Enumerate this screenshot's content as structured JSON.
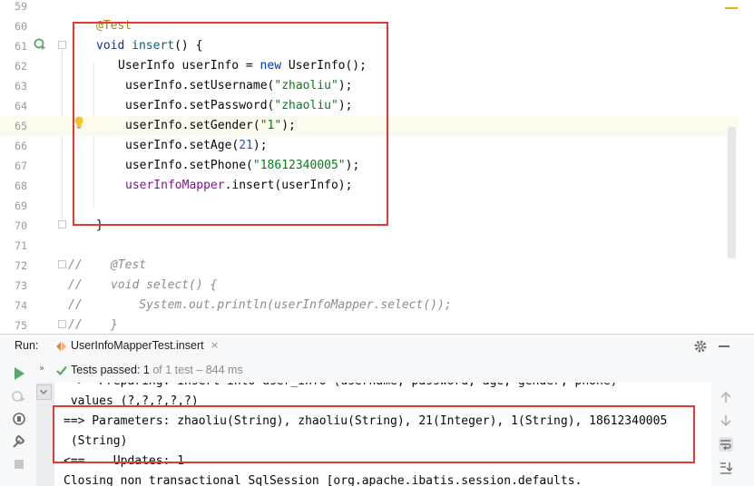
{
  "editor": {
    "line_numbers": [
      "59",
      "60",
      "61",
      "62",
      "63",
      "64",
      "65",
      "66",
      "67",
      "68",
      "69",
      "70",
      "71",
      "72",
      "73",
      "74",
      "75"
    ],
    "code": {
      "l60_annotation": "@Test",
      "l61_void": "void",
      "l61_method": "insert",
      "l61_rest": "() {",
      "l62_a": "UserInfo userInfo = ",
      "l62_new": "new",
      "l62_b": " UserInfo();",
      "l63_a": "userInfo.setUsername(",
      "l63_str": "\"zhaoliu\"",
      "l63_b": ");",
      "l64_a": "userInfo.setPassword(",
      "l64_str": "\"zhaoliu\"",
      "l64_b": ");",
      "l65_a": "userInfo.setGender(",
      "l65_str": "\"1\"",
      "l65_b": ");",
      "l66_a": "userInfo.setAge(",
      "l66_num": "21",
      "l66_b": ");",
      "l67_a": "userInfo.setPhone(",
      "l67_str": "\"18612340005\"",
      "l67_b": ");",
      "l68_field": "userInfoMapper",
      "l68_b": ".insert(userInfo);",
      "l70_brace": "}",
      "l72_comment": "//    @Test",
      "l73_comment": "//    void select() {",
      "l74_comment": "//        System.out.println(userInfoMapper.select());",
      "l75_comment": "//    }"
    }
  },
  "run_panel": {
    "label": "Run:",
    "tab_label": "UserInfoMapperTest.insert",
    "tab_close": "×",
    "status": {
      "label": "Tests passed: ",
      "count": "1",
      "detail": " of 1 test – 844 ms"
    },
    "console_lines": [
      "==>  Preparing: insert into user_info (username, password, age, gender, phone)",
      " values (?,?,?,?,?)",
      "==> Parameters: zhaoliu(String), zhaoliu(String), 21(Integer), 1(String), 18612340005",
      " (String)",
      "<==    Updates: 1",
      "Closing non transactional SqlSession [org.apache.ibatis.session.defaults."
    ]
  },
  "colors": {
    "highlight_box": "#e53935",
    "test_passed": "#59a869"
  }
}
